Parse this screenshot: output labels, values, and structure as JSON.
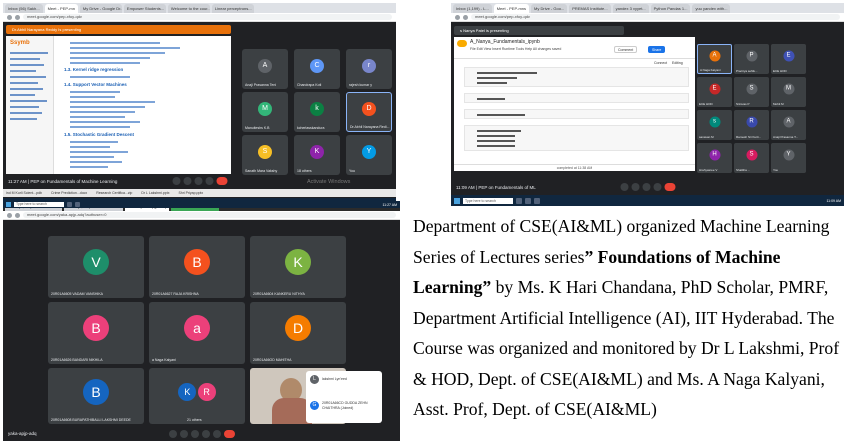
{
  "description": {
    "part1": "Department of CSE(AI&ML) organized Machine Learning Series of Lectures series",
    "title_quoted": "” Foundations of Machine Learning”",
    "part2": " by Ms. K Hari Chandana, PhD Scholar, PMRF, Department Artificial Intelligence (AI), IIT Hyderabad. The Course was organized and monitored by Dr L Lakshmi, Prof & HOD, Dept. of CSE(AI&ML) and Ms. A Naga Kalyani, Asst. Prof, Dept. of CSE(AI&ML)"
  },
  "shot1": {
    "tabs": [
      "Inbox (56) Sakh...",
      "Meet - PEP-mn",
      "My Drive - Google Dr...",
      "Empower Students...",
      "Welcome to the cour...",
      "Linear perceptrons..."
    ],
    "url": "meet.google.com/pep-xfoy-qdv",
    "presenting": "Dr.Abhil Narayana Reddy Is presenting",
    "slide_title": "Ssymb",
    "slide_headings": [
      "1.3. Kernel ridge regression",
      "1.4. Support Vector Machines",
      "1.5. Stochastic Gradient Descent"
    ],
    "participants": [
      {
        "name": "Anaji Prasanna Teni",
        "initial": "A",
        "color": "#5f6368"
      },
      {
        "name": "Chandrapa Koti",
        "initial": "C",
        "color": "#5e97f6"
      },
      {
        "name": "rajesh kumar y",
        "initial": "r",
        "color": "#7986cb"
      },
      {
        "name": "Manuiteshs K.B",
        "initial": "M",
        "color": "#33b679"
      },
      {
        "name": "kcherlasskandura",
        "initial": "k",
        "color": "#0b8043"
      },
      {
        "name": "Dr.Abhil Narayana Redi...",
        "initial": "D",
        "color": "#f4511e"
      },
      {
        "name": "Sanath Mara Vakshy",
        "initial": "S",
        "color": "#f6bf26"
      },
      {
        "name": "18 others",
        "initial": "K",
        "color": "#8e24aa"
      },
      {
        "name": "You",
        "initial": "Y",
        "color": "#039be5"
      }
    ],
    "footer": "11:27 AM | PEP on Fundamentals of Machine Learning",
    "watermark": "Activate Windows",
    "taskbar_search": "Type here to search",
    "taskbar_time": "11:27 AM",
    "lower_tabs": [
      "ind M Kurli Scient...pdb",
      "Crime Prediction...docx",
      "Research Certifica...zip",
      "Dr L Lakshmi.pptx",
      "Shri Priyap.pptx"
    ]
  },
  "shot2": {
    "tabs": [
      "Inbox (1,199) - L...",
      "Meet - PEP-mns",
      "My Drive - Goo...",
      "PREMAS Institute...",
      "yandex 3 vyyet...",
      "Python Pandas 1...",
      "yuu yandex with..."
    ],
    "url": "meet.google.com/pep-xfoy-qdv",
    "presenting": "s Nanya Patel is presenting",
    "notebook_title": "A_Nanya_Fundamentals_ipynb",
    "menu": "File  Edit  View  Insert  Runtime  Tools  Help   All changes saved",
    "buttons": {
      "comment": "Comment",
      "share": "Share",
      "connect": "Connect",
      "editing": "Editing"
    },
    "status": "completed at 11:38 AM",
    "participants": [
      {
        "name": "A Naga Kalyani",
        "initial": "A",
        "color": "#e8710a"
      },
      {
        "name": "Pracriya sehtk...",
        "initial": "P",
        "color": "#5f6368"
      },
      {
        "name": "ECE HOD",
        "initial": "E",
        "color": "#3f51b5"
      },
      {
        "name": "ECE HOD",
        "initial": "E",
        "color": "#c62828"
      },
      {
        "name": "Srinivas P",
        "initial": "S",
        "color": "#5f6368"
      },
      {
        "name": "Mohit M",
        "initial": "M",
        "color": "#5f6368"
      },
      {
        "name": "sanavan M",
        "initial": "s",
        "color": "#00897b"
      },
      {
        "name": "Ramesh Sri Kurti...",
        "initial": "R",
        "color": "#3949ab"
      },
      {
        "name": "Anaji Prasanna T...",
        "initial": "A",
        "color": "#5f6368"
      },
      {
        "name": "Hrahyasree V",
        "initial": "H",
        "color": "#8e24aa"
      },
      {
        "name": "Shalitha ...",
        "initial": "S",
        "color": "#d81b60"
      },
      {
        "name": "You",
        "initial": "Y",
        "color": "#5f6368"
      }
    ],
    "footer": "11:09 AM | PEP on Fundamentals of ML",
    "taskbar_search": "Type here to search",
    "taskbar_time": "11:09 AM"
  },
  "shot3": {
    "tabs": [
      "Inbox (1,876) - Lakshmi.ad...",
      "Inbox (9,811) - av.Kusana G...",
      "Meet - yake-apjp-adq",
      "Fresh Jobs from India..."
    ],
    "url": "meet.google.com/yaka-apjp-adq?authuser=0",
    "participants": [
      {
        "name": "20R01A6605 VADAM VANSHIKA",
        "initial": "V",
        "color": "#1e8e6a"
      },
      {
        "name": "20R01A6627 RAJA KRISHNA",
        "initial": "B",
        "color": "#f4511e"
      },
      {
        "name": "20R01A6604 KANKERU NITHYA",
        "initial": "K",
        "color": "#7cb342"
      },
      {
        "name": "20R01A6626 BANDARI NIKHILA",
        "initial": "B",
        "color": "#ec407a"
      },
      {
        "name": "a Naga Kalyani",
        "initial": "a",
        "color": "#ec407a"
      },
      {
        "name": "20R01A66OD MAHITHA",
        "initial": "D",
        "color": "#f57c00"
      },
      {
        "name": "20R01A6608 BURAPATHIBALLI LAKSHMI DEEDE",
        "initial": "B",
        "color": "#1565c0"
      },
      {
        "name": "21 others",
        "initial": "K",
        "color": "#ec407a"
      }
    ],
    "side_panel": [
      {
        "name": "lakshmi Lyn'eed",
        "initial": "L"
      },
      {
        "name": "20R01A66CD GUDDA ZEHN CHAITHRA (Joined)",
        "initial": "G"
      }
    ],
    "meeting_code": "yaka-apjp-adq",
    "taskbar_search": "Type here to search",
    "taskbar_time": "11:27 AM"
  }
}
